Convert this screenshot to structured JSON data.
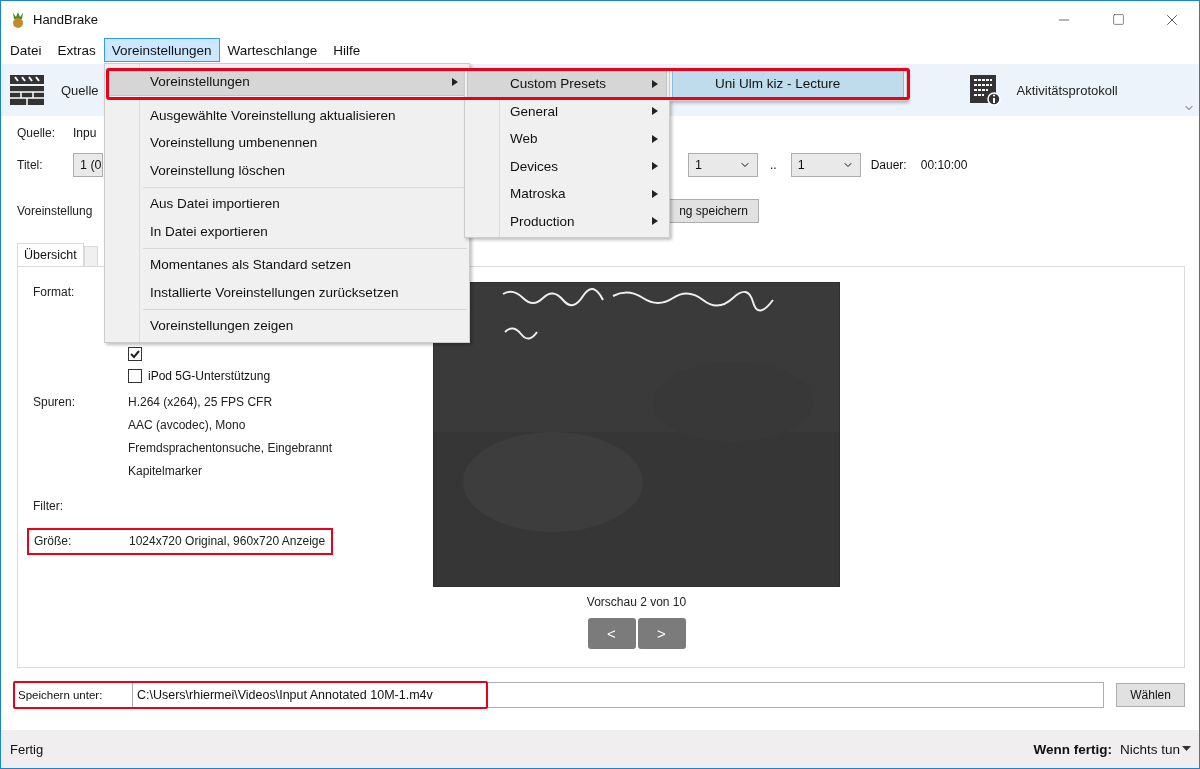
{
  "window": {
    "title": "HandBrake"
  },
  "menu_bar": [
    {
      "label": "Datei",
      "selected": false
    },
    {
      "label": "Extras",
      "selected": false
    },
    {
      "label": "Voreinstellungen",
      "selected": true
    },
    {
      "label": "Warteschlange",
      "selected": false
    },
    {
      "label": "Hilfe",
      "selected": false
    }
  ],
  "toolbar": [
    {
      "label": "Quelle"
    },
    {
      "label": "Aktivitätsprotokoll"
    }
  ],
  "source": {
    "label": "Quelle:",
    "value": "Inpu"
  },
  "title_row": {
    "label": "Titel:",
    "title_value": "1 (0",
    "range_start": "1",
    "range_sep": "..",
    "range_end": "1",
    "duration_label": "Dauer:",
    "duration": "00:10:00"
  },
  "preset_row": {
    "label": "Voreinstellung",
    "save_button": "ng speichern"
  },
  "tabs": [
    {
      "label": "Übersicht",
      "selected": true
    },
    {
      "selected": false
    }
  ],
  "summary": {
    "format_label": "Format:",
    "options": [
      {
        "checked": true
      },
      {
        "label": "iPod 5G-Unterstützung",
        "checked": false
      }
    ],
    "tracks_label": "Spuren:",
    "tracks": [
      "H.264 (x264), 25 FPS CFR",
      "AAC (avcodec), Mono",
      "Fremdsprachentonsuche, Eingebrannt",
      "Kapitelmarker"
    ],
    "filter_label": "Filter:",
    "size": {
      "label": "Größe:",
      "value": "1024x720 Original, 960x720 Anzeige",
      "highlighted": true
    }
  },
  "preview": {
    "kind": "picture",
    "caption": "Vorschau 2 von 10",
    "prev": "<",
    "next": ">"
  },
  "destination": {
    "label": "Speichern unter:",
    "value": "C:\\Users\\rhiermei\\Videos\\Input Annotated 10M-1.m4v",
    "button": "Wählen",
    "highlighted": true
  },
  "status_bar": {
    "status": "Fertig",
    "when_done_label": "Wenn fertig:",
    "when_done_value": "Nichts tun"
  },
  "menus": [
    {
      "items": [
        {
          "kind": "item",
          "label": "Voreinstellungen",
          "submenu": true,
          "selected": true,
          "highlighted": true
        },
        {
          "kind": "separator"
        },
        {
          "kind": "item",
          "label": "Ausgewählte Voreinstellung aktualisieren",
          "submenu": false,
          "selected": false
        },
        {
          "kind": "item",
          "label": "Voreinstellung umbenennen",
          "submenu": false,
          "selected": false
        },
        {
          "kind": "item",
          "label": "Voreinstellung löschen",
          "submenu": false,
          "selected": false
        },
        {
          "kind": "separator"
        },
        {
          "kind": "item",
          "label": "Aus Datei importieren",
          "submenu": false,
          "selected": false
        },
        {
          "kind": "item",
          "label": "In Datei exportieren",
          "submenu": false,
          "selected": false
        },
        {
          "kind": "separator"
        },
        {
          "kind": "item",
          "label": "Momentanes als Standard setzen",
          "submenu": false,
          "selected": false
        },
        {
          "kind": "item",
          "label": "Installierte Voreinstellungen zurücksetzen",
          "submenu": false,
          "selected": false
        },
        {
          "kind": "separator"
        },
        {
          "kind": "item",
          "label": "Voreinstellungen zeigen",
          "submenu": false,
          "selected": false
        }
      ]
    },
    {
      "items": [
        {
          "kind": "item",
          "label": "Custom Presets",
          "submenu": true,
          "selected": true
        },
        {
          "kind": "item",
          "label": "General",
          "submenu": true,
          "selected": false
        },
        {
          "kind": "item",
          "label": "Web",
          "submenu": true,
          "selected": false
        },
        {
          "kind": "item",
          "label": "Devices",
          "submenu": true,
          "selected": false
        },
        {
          "kind": "item",
          "label": "Matroska",
          "submenu": true,
          "selected": false
        },
        {
          "kind": "item",
          "label": "Production",
          "submenu": true,
          "selected": false
        }
      ]
    },
    {
      "items": [
        {
          "kind": "item",
          "label": "Uni Ulm kiz - Lecture",
          "submenu": false,
          "selected": true
        }
      ]
    }
  ]
}
